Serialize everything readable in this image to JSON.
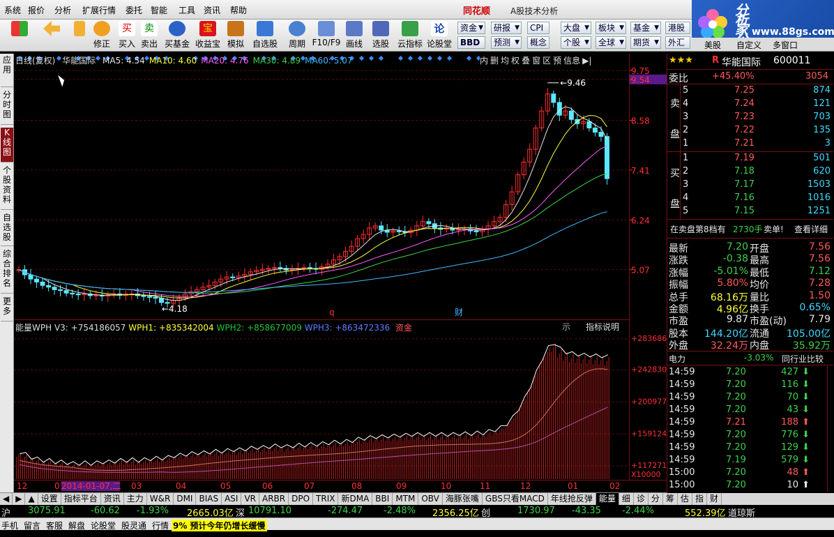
{
  "menu": {
    "items": [
      "系统",
      "报价",
      "分析",
      "扩展行情",
      "委托",
      "智能",
      "工具",
      "资讯",
      "帮助"
    ],
    "app_title": "同花顺",
    "app_subtitle": "A股技术分析"
  },
  "logo": {
    "text": "分析家公式网",
    "url": "www.88gs.com"
  },
  "toolbar": {
    "buttons": [
      "修正",
      "买入",
      "卖出",
      "买基金",
      "收益宝",
      "模拟",
      "自选股",
      "周期",
      "F10/F9",
      "画线",
      "选股",
      "云指标",
      "论股堂"
    ],
    "small_buttons": [
      [
        "资金",
        "BBD"
      ],
      [
        "研报",
        "预测"
      ],
      [
        "CPI",
        "概念"
      ],
      [
        "大盘",
        "个股"
      ],
      [
        "板块",
        "全球"
      ],
      [
        "基金",
        "期货"
      ],
      [
        "港股",
        "外汇"
      ],
      [
        "",
        "美股"
      ]
    ]
  },
  "left_tabs": [
    "应用",
    "分时图",
    "K线图",
    "个股资料",
    "自选股",
    "综合排名",
    "更多"
  ],
  "kline": {
    "header_label": "日线(复权)",
    "stock": "华能国际",
    "ma": [
      {
        "n": "MA5",
        "v": "4.54",
        "c": "#e8e8e8"
      },
      {
        "n": "MA10",
        "v": "4.60",
        "c": "#ffff3c"
      },
      {
        "n": "MA20",
        "v": "4.76",
        "c": "#ff5cff"
      },
      {
        "n": "MA30",
        "v": "4.89",
        "c": "#3fd24a"
      },
      {
        "n": "MA60",
        "v": "5.07",
        "c": "#40b8ff"
      }
    ],
    "tools": [
      "内",
      "删",
      "均",
      "权",
      "叠",
      "窗",
      "区",
      "预",
      "信息"
    ],
    "price_ticks": [
      {
        "p": 9.75,
        "t": "9.75"
      },
      {
        "p": 9.54,
        "t": "9.54"
      },
      {
        "p": 8.58,
        "t": "8.58"
      },
      {
        "p": 7.41,
        "t": "7.41"
      },
      {
        "p": 6.24,
        "t": "6.24"
      },
      {
        "p": 5.07,
        "t": "5.07"
      }
    ],
    "high_label": "9.46",
    "low_label": "4.18",
    "markers": [
      "q",
      "财"
    ],
    "ohlc_note": "closing price path",
    "close": [
      5.07,
      4.95,
      4.85,
      4.78,
      4.7,
      4.66,
      4.6,
      4.58,
      4.52,
      4.5,
      4.48,
      4.5,
      4.46,
      4.47,
      4.45,
      4.48,
      4.5,
      4.47,
      4.5,
      4.5,
      4.46,
      4.44,
      4.42,
      4.4,
      4.3,
      4.28,
      4.35,
      4.42,
      4.5,
      4.55,
      4.6,
      4.66,
      4.7,
      4.78,
      4.85,
      4.9,
      4.88,
      4.92,
      4.96,
      5.02,
      5.05,
      5.08,
      5.1,
      5.12,
      5.1,
      5.06,
      5.08,
      5.1,
      5.12,
      5.1,
      5.08,
      5.14,
      5.2,
      5.3,
      5.38,
      5.5,
      5.62,
      5.8,
      5.9,
      6.05,
      6.1,
      6.0,
      5.95,
      5.98,
      5.96,
      5.94,
      6.0,
      6.1,
      6.2,
      6.15,
      6.05,
      6.02,
      6.05,
      6.0,
      6.02,
      6.03,
      5.98,
      5.96,
      6.02,
      6.1,
      6.2,
      6.3,
      6.6,
      6.9,
      7.3,
      7.6,
      7.9,
      8.4,
      8.8,
      9.2,
      9.0,
      8.7,
      8.8,
      8.6,
      8.5,
      8.55,
      8.4,
      8.3,
      8.2,
      7.21
    ]
  },
  "indicator": {
    "name": "能量WPH V3",
    "v": "+754186057",
    "wph1": "+835342004",
    "wph2": "+858677009",
    "wph3": "+863472336",
    "tag": "资金",
    "help": "指标说明",
    "ticks": [
      "+283686",
      "+242830",
      "+200977",
      "+159124",
      "+117271",
      "X10000"
    ],
    "values": [
      135,
      132,
      128,
      126,
      124,
      124,
      122,
      122,
      121,
      120,
      120,
      121,
      120,
      121,
      122,
      122,
      123,
      124,
      124,
      125,
      124,
      125,
      126,
      127,
      127,
      128,
      130,
      131,
      132,
      133,
      134,
      134,
      135,
      136,
      136,
      137,
      138,
      138,
      139,
      140,
      141,
      141,
      142,
      143,
      143,
      142,
      143,
      144,
      144,
      145,
      145,
      146,
      147,
      148,
      148,
      149,
      150,
      152,
      153,
      154,
      155,
      155,
      156,
      156,
      157,
      157,
      158,
      158,
      158,
      158,
      158,
      158,
      158,
      158,
      159,
      159,
      159,
      160,
      160,
      162,
      164,
      167,
      172,
      180,
      192,
      205,
      222,
      240,
      258,
      272,
      278,
      270,
      266,
      264,
      263,
      262,
      262,
      261,
      261,
      260
    ]
  },
  "date_axis": [
    "12",
    "01",
    "2014-01-07,二",
    "03",
    "04",
    "05",
    "06",
    "07",
    "08",
    "09",
    "10",
    "11",
    "12",
    "01",
    "02"
  ],
  "bottom_tabs": [
    "设置",
    "指标平台",
    "资讯",
    "主力",
    "W&R",
    "DMI",
    "BIAS",
    "ASI",
    "VR",
    "ARBR",
    "DPO",
    "TRIX",
    "新DMA",
    "BBI",
    "MTM",
    "OBV",
    "海豚张嘴",
    "GBS只看MACD",
    "年线抢反弹",
    "能量",
    "细",
    "诊",
    "分",
    "筹",
    "估",
    "指",
    "财"
  ],
  "ticker": {
    "sh_label": "沪",
    "sh_val": "3075.91",
    "sh_chg": "-60.62",
    "sh_pct": "-1.93%",
    "sh_amt": "2665.03亿",
    "sz_label": "深",
    "sz_val": "10791.10",
    "sz_chg": "-274.47",
    "sz_pct": "-2.48%",
    "sz_amt": "2356.25亿",
    "cy_label": "创",
    "cy_val": "1730.97",
    "cy_chg": "-43.35",
    "cy_pct": "-2.44%",
    "cy_amt": "552.39亿",
    "dj": "道琼斯"
  },
  "status": {
    "items": [
      "手机",
      "留言",
      "客服",
      "解盘",
      "论股堂",
      "股灵通",
      "行情"
    ],
    "news": "9% 预计今年仍增长缓慢"
  },
  "quote": {
    "stars": "★★★",
    "r": "R",
    "name": "华能国际",
    "code": "600011",
    "webi_label": "委比",
    "webi": "+45.40%",
    "webi_vol": "3054",
    "ask_label": "卖盘",
    "bid_label": "买盘",
    "asks": [
      {
        "n": "5",
        "p": "7.25",
        "v": "874"
      },
      {
        "n": "4",
        "p": "7.24",
        "v": "121"
      },
      {
        "n": "3",
        "p": "7.23",
        "v": "703"
      },
      {
        "n": "2",
        "p": "7.22",
        "v": "135"
      },
      {
        "n": "1",
        "p": "7.21",
        "v": "3"
      }
    ],
    "bids": [
      {
        "n": "1",
        "p": "7.19",
        "v": "501"
      },
      {
        "n": "2",
        "p": "7.18",
        "v": "620"
      },
      {
        "n": "3",
        "p": "7.17",
        "v": "1503"
      },
      {
        "n": "4",
        "p": "7.16",
        "v": "1016"
      },
      {
        "n": "5",
        "p": "7.15",
        "v": "1251"
      }
    ],
    "note_a": "在卖盘第8档有",
    "note_b": "2730手",
    "note_c": "卖单!",
    "note_d": "查看详细",
    "stats": [
      [
        "最新",
        "7.20",
        "开盘",
        "7.56"
      ],
      [
        "涨跌",
        "-0.38",
        "最高",
        "7.56"
      ],
      [
        "涨幅",
        "-5.01%",
        "最低",
        "7.12"
      ],
      [
        "振幅",
        "5.80%",
        "均价",
        "7.28"
      ],
      [
        "总手",
        "68.16万",
        "量比",
        "1.50"
      ],
      [
        "金额",
        "4.96亿",
        "换手",
        "0.65%"
      ],
      [
        "市盈",
        "9.87",
        "市盈(动)",
        "7.79"
      ],
      [
        "股本",
        "144.20亿",
        "流通",
        "105.00亿"
      ],
      [
        "外盘",
        "32.24万",
        "内盘",
        "35.92万"
      ]
    ],
    "sector_label": "电力",
    "sector_pct": "-3.03%",
    "compare": "同行业比较",
    "trades": [
      {
        "t": "14:59",
        "p": "7.20",
        "v": "427",
        "d": "down"
      },
      {
        "t": "14:59",
        "p": "7.20",
        "v": "116",
        "d": "down"
      },
      {
        "t": "14:59",
        "p": "7.20",
        "v": "70",
        "d": "down"
      },
      {
        "t": "14:59",
        "p": "7.20",
        "v": "43",
        "d": "down"
      },
      {
        "t": "14:59",
        "p": "7.21",
        "v": "188",
        "d": "up"
      },
      {
        "t": "14:59",
        "p": "7.20",
        "v": "776",
        "d": "down"
      },
      {
        "t": "14:59",
        "p": "7.20",
        "v": "129",
        "d": "down"
      },
      {
        "t": "14:59",
        "p": "7.19",
        "v": "579",
        "d": "down"
      },
      {
        "t": "15:00",
        "p": "7.20",
        "v": "48",
        "d": "up"
      },
      {
        "t": "15:00",
        "p": "7.20",
        "v": "10",
        "d": "flat"
      }
    ]
  }
}
